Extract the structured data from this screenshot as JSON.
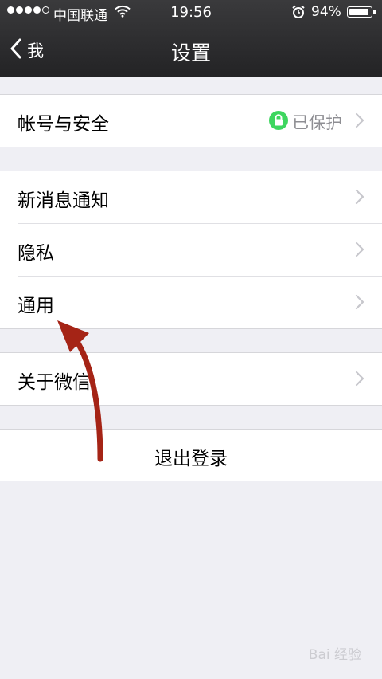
{
  "status_bar": {
    "carrier": "中国联通",
    "time": "19:56",
    "battery": "94%",
    "battery_level": 0.94
  },
  "nav": {
    "back_label": "我",
    "title": "设置"
  },
  "groups": [
    {
      "items": [
        {
          "label": "帐号与安全",
          "detail": "已保护"
        }
      ]
    },
    {
      "items": [
        {
          "label": "新消息通知"
        },
        {
          "label": "隐私"
        },
        {
          "label": "通用"
        }
      ]
    },
    {
      "items": [
        {
          "label": "关于微信"
        }
      ]
    }
  ],
  "logout": {
    "label": "退出登录"
  },
  "icons": {
    "back": "chevron-left-icon",
    "disclosure": "chevron-right-icon",
    "protect": "lock-icon",
    "wifi": "wifi-icon",
    "alarm": "alarm-icon"
  },
  "colors": {
    "header": "#2c2c2e",
    "background": "#efeff4",
    "protect_green": "#3ed65f",
    "annotation_arrow": "#a52416"
  },
  "watermark": "Bai 经验"
}
